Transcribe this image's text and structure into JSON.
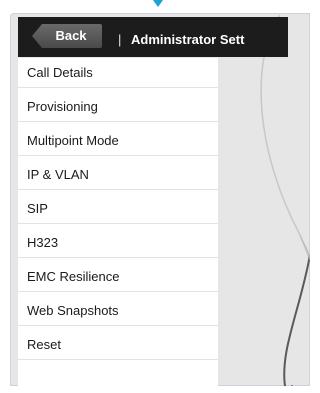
{
  "header": {
    "back_label": "Back",
    "separator": "|",
    "title": "Administrator Sett"
  },
  "menu": {
    "items": [
      {
        "label": "Call Details"
      },
      {
        "label": "Provisioning"
      },
      {
        "label": "Multipoint Mode"
      },
      {
        "label": "IP & VLAN"
      },
      {
        "label": "SIP"
      },
      {
        "label": "H323"
      },
      {
        "label": "EMC Resilience"
      },
      {
        "label": "Web Snapshots"
      },
      {
        "label": "Reset"
      },
      {
        "label": ""
      }
    ]
  },
  "colors": {
    "header_bg": "#1c1c1c",
    "back_button": "#555555",
    "panel_bg": "#e6e6e6",
    "pointer_accent": "#1aa3d4"
  }
}
